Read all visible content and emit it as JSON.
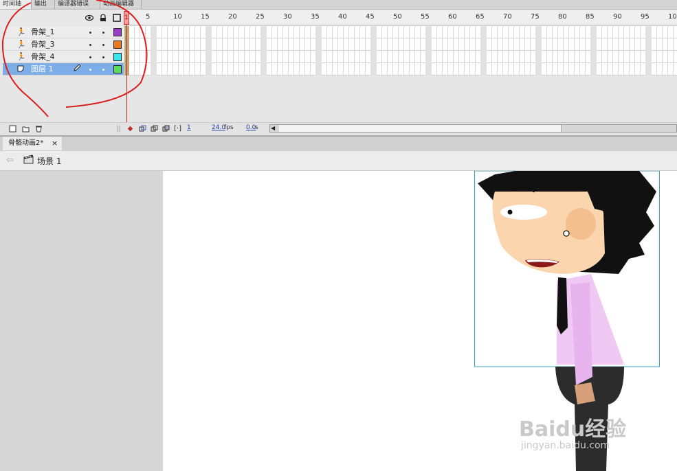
{
  "top_tabs": [
    "时间轴",
    "输出",
    "编译器错误",
    "动画编辑器"
  ],
  "layers": [
    {
      "name": "骨架_1",
      "icon": "armature-icon",
      "color": "#9b3fc4",
      "selected": false
    },
    {
      "name": "骨架_3",
      "icon": "armature-icon",
      "color": "#e8781e",
      "selected": false
    },
    {
      "name": "骨架_4",
      "icon": "armature-icon",
      "color": "#37e6ee",
      "selected": false
    },
    {
      "name": "图层 1",
      "icon": "layer-icon",
      "color": "#5adc5a",
      "selected": true
    }
  ],
  "header_icons": [
    "eye-icon",
    "lock-icon",
    "outline-icon"
  ],
  "frame_numbers": [
    "1",
    "5",
    "10",
    "15",
    "20",
    "25",
    "30",
    "35",
    "40",
    "45",
    "50",
    "55",
    "60",
    "65",
    "70",
    "75",
    "80",
    "85",
    "90",
    "95",
    "10"
  ],
  "footer": {
    "current_frame": "1",
    "fps": "24.0",
    "fps_unit": "fps",
    "time": "0.0",
    "time_unit": "s"
  },
  "document_tab": "骨骼动画2*",
  "scene": "场景 1",
  "watermark": {
    "line1": "Baidu经验",
    "line2": "jingyan.baidu.com"
  },
  "colors": {
    "selected_row": "#7eaee8",
    "playhead": "#cc2020",
    "annotation_red": "#d81e1e"
  }
}
